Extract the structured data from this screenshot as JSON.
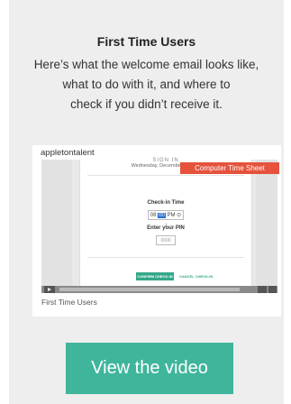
{
  "card": {
    "title": "First Time Users",
    "description_lines": [
      "Here’s what the welcome email looks like,",
      "what to do with it, and where to",
      "check if you didn’t receive it."
    ]
  },
  "video": {
    "brand": "appletontalent",
    "overlay_label": "Computer Time Sheet",
    "caption": "First Time Users",
    "screen": {
      "cut_top_text": "SIGN IN",
      "date": "Wednesday, December 9, 2015",
      "checkin_label": "Check-in Time",
      "time_hour": "08:",
      "time_selected": "00",
      "time_suffix": " PM ⊙ ↕",
      "pin_label": "Enter your PIN",
      "pin_placeholder": "0000",
      "confirm_label": "CONFIRM CHECK-IN",
      "cancel_label": "CANCEL CHECK-IN"
    }
  },
  "cta": {
    "label": "View the video"
  },
  "colors": {
    "card_bg": "#eeeeee",
    "accent": "#3fb59b",
    "overlay": "#e6533c"
  }
}
